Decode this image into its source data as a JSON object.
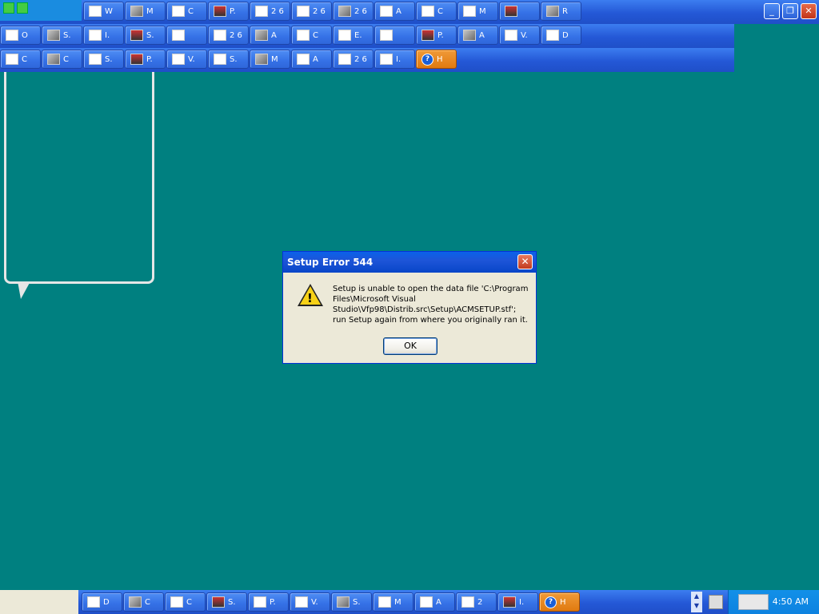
{
  "colors": {
    "desktop": "#008080",
    "taskbar": "#2458d6",
    "active_button": "#e07a10",
    "dialog_bg": "#ece9d8"
  },
  "top_taskbar": {
    "row1": [
      "W",
      "M",
      "C",
      "P.",
      "2 6",
      "2 6",
      "2 6",
      "A",
      "C",
      "M",
      "",
      "R"
    ],
    "row2": [
      "O",
      "S.",
      "I.",
      "S.",
      "",
      "2 6",
      "A",
      "C",
      "E.",
      "",
      "P.",
      "A",
      "V.",
      "D"
    ],
    "row3": [
      "C",
      "C",
      "S.",
      "P.",
      "V.",
      "S.",
      "M",
      "A",
      "2 6",
      "I.",
      "H"
    ]
  },
  "dialog": {
    "title": "Setup Error 544",
    "message": "Setup is unable to open the data file 'C:\\Program Files\\Microsoft Visual Studio\\Vfp98\\Distrib.src\\Setup\\ACMSETUP.stf'; run Setup again from where you originally ran it.",
    "ok_label": "OK",
    "icon": "warning-icon"
  },
  "bottom_taskbar": {
    "buttons": [
      "D",
      "C",
      "C",
      "S.",
      "P.",
      "V.",
      "S.",
      "M",
      "A",
      "2",
      "I.",
      "H"
    ],
    "clock": "4:50 AM"
  }
}
